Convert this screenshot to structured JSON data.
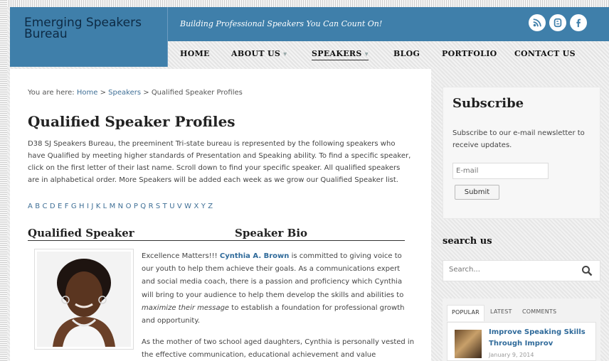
{
  "site": {
    "logo_line1": "Emerging Speakers",
    "logo_line2": "Bureau",
    "tagline": "Building Professional Speakers You Can Count On!"
  },
  "social": [
    "rss-icon",
    "blogger-icon",
    "facebook-icon"
  ],
  "nav": {
    "home": "HOME",
    "about": "ABOUT US",
    "speakers": "SPEAKERS",
    "blog": "BLOG",
    "portfolio": "PORTFOLIO",
    "contact": "CONTACT US",
    "dropdown_caret": "▾"
  },
  "breadcrumb": {
    "prefix": "You are here:",
    "home": "Home",
    "speakers": "Speakers",
    "current": "Qualified Speaker Profiles",
    "sep": ">"
  },
  "main": {
    "title": "Qualified Speaker Profiles",
    "intro": "D38 SJ Speakers Bureau, the preeminent Tri-state bureau is represented by the following speakers who have Qualified by meeting higher standards of Presentation and Speaking ability. To find a specific speaker, click on the first letter of their last name. Scroll down to find your specific speaker. All qualified speakers are in alphabetical order. More Speakers will be added each week as we grow our Qualified Speaker list.",
    "letters": [
      "A",
      "B",
      "C",
      "D",
      "E",
      "F",
      "G",
      "H",
      "I",
      "J",
      "K",
      "L",
      "M",
      "N",
      "O",
      "P",
      "Q",
      "R",
      "S",
      "T",
      "U",
      "V",
      "W",
      "X",
      "Y",
      "Z"
    ],
    "col_speaker": "Qualified Speaker",
    "col_bio": "Speaker Bio",
    "bio_part1": "Excellence Matters!!! ",
    "bio_name": "Cynthia A. Brown",
    "bio_part2": " is committed to giving voice to our youth to help them achieve their goals. As a communications expert and social media coach, there is a passion and proficiency which Cynthia will bring to your audience to help them develop the skills and abilities to ",
    "bio_em": "maximize their message",
    "bio_part3": " to establish a foundation for professional growth and opportunity.",
    "bio2": "As the mother of two school aged daughters, Cynthia is personally vested in the effective communication, educational achievement and value"
  },
  "sidebar": {
    "subscribe_title": "Subscribe",
    "subscribe_text": "Subscribe to our e-mail newsletter to receive updates.",
    "email_placeholder": "E-mail",
    "submit_label": "Submit",
    "search_title": "search us",
    "search_placeholder": "Search...",
    "tabs": [
      "POPULAR",
      "LATEST",
      "COMMENTS"
    ],
    "post_title": "Improve Speaking Skills Through Improv",
    "post_date": "January 9, 2014"
  },
  "colors": {
    "header_blue": "#3f7faa",
    "link_blue": "#3f6f96"
  }
}
